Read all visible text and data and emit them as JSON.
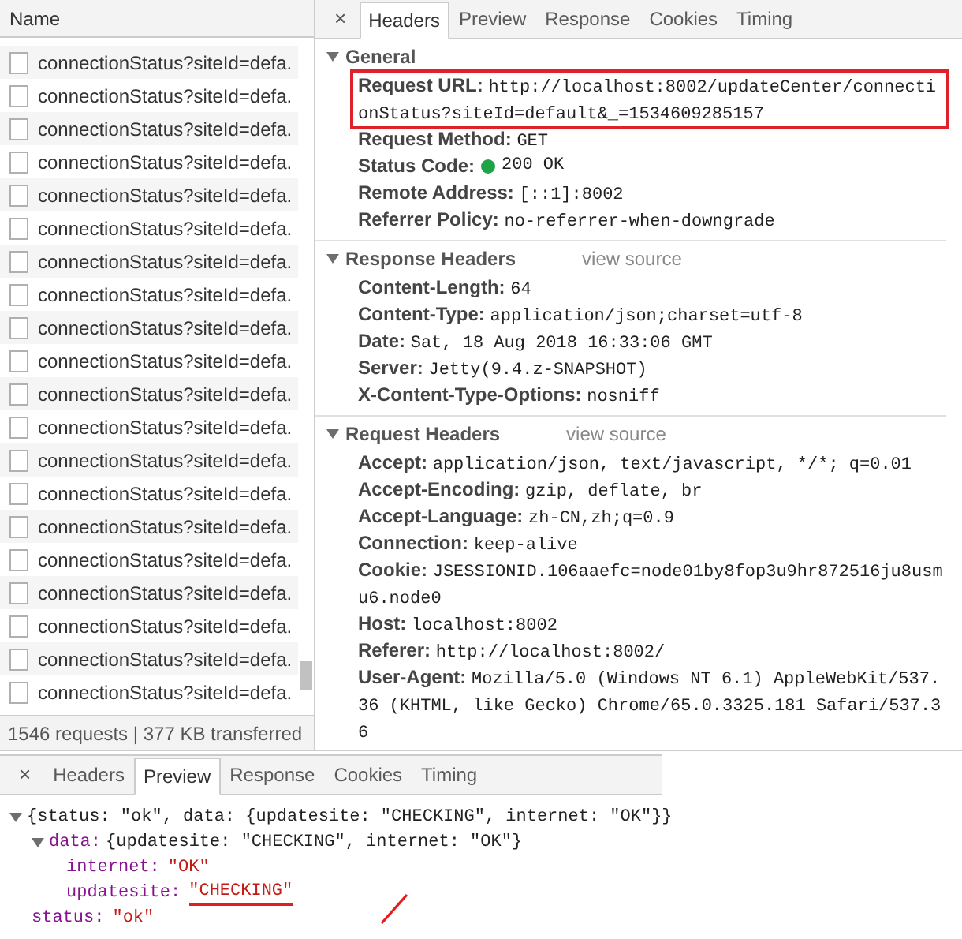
{
  "requests": {
    "header": "Name",
    "rows": [
      "connectionStatus?siteId=defa.",
      "connectionStatus?siteId=defa.",
      "connectionStatus?siteId=defa.",
      "connectionStatus?siteId=defa.",
      "connectionStatus?siteId=defa.",
      "connectionStatus?siteId=defa.",
      "connectionStatus?siteId=defa.",
      "connectionStatus?siteId=defa.",
      "connectionStatus?siteId=defa.",
      "connectionStatus?siteId=defa.",
      "connectionStatus?siteId=defa.",
      "connectionStatus?siteId=defa.",
      "connectionStatus?siteId=defa.",
      "connectionStatus?siteId=defa.",
      "connectionStatus?siteId=defa.",
      "connectionStatus?siteId=defa.",
      "connectionStatus?siteId=defa.",
      "connectionStatus?siteId=defa.",
      "connectionStatus?siteId=defa.",
      "connectionStatus?siteId=defa."
    ],
    "status_bar": "1546 requests | 377 KB transferred"
  },
  "details": {
    "close": "×",
    "tabs": [
      {
        "label": "Headers",
        "selected": true
      },
      {
        "label": "Preview",
        "selected": false
      },
      {
        "label": "Response",
        "selected": false
      },
      {
        "label": "Cookies",
        "selected": false
      },
      {
        "label": "Timing",
        "selected": false
      }
    ],
    "sections": [
      {
        "title": "General",
        "expanded": true,
        "fields": [
          {
            "key": "Request URL:",
            "value": "http://localhost:8002/updateCenter/connectionStatus?siteId=default&_=1534609285157",
            "highlighted": true
          },
          {
            "key": "Request Method:",
            "value": "GET",
            "highlighted": false
          },
          {
            "key": "Status Code:",
            "value": "200 OK",
            "kind": "status",
            "highlighted": false
          },
          {
            "key": "Remote Address:",
            "value": "[::1]:8002",
            "highlighted": false
          },
          {
            "key": "Referrer Policy:",
            "value": "no-referrer-when-downgrade",
            "highlighted": false
          }
        ]
      },
      {
        "title": "Response Headers",
        "link": "view source",
        "expanded": true,
        "fields": [
          {
            "key": "Content-Length:",
            "value": "64",
            "highlighted": false
          },
          {
            "key": "Content-Type:",
            "value": "application/json;charset=utf-8",
            "highlighted": false
          },
          {
            "key": "Date:",
            "value": "Sat, 18 Aug 2018 16:33:06 GMT",
            "highlighted": false
          },
          {
            "key": "Server:",
            "value": "Jetty(9.4.z-SNAPSHOT)",
            "highlighted": false
          },
          {
            "key": "X-Content-Type-Options:",
            "value": "nosniff",
            "highlighted": false
          }
        ]
      },
      {
        "title": "Request Headers",
        "link": "view source",
        "expanded": true,
        "fields": [
          {
            "key": "Accept:",
            "value": "application/json, text/javascript, */*; q=0.01",
            "highlighted": false
          },
          {
            "key": "Accept-Encoding:",
            "value": "gzip, deflate, br",
            "highlighted": false
          },
          {
            "key": "Accept-Language:",
            "value": "zh-CN,zh;q=0.9",
            "highlighted": false
          },
          {
            "key": "Connection:",
            "value": "keep-alive",
            "highlighted": false
          },
          {
            "key": "Cookie:",
            "value": "JSESSIONID.106aaefc=node01by8fop3u9hr872516ju8usmu6.node0",
            "highlighted": false
          },
          {
            "key": "Host:",
            "value": "localhost:8002",
            "highlighted": false
          },
          {
            "key": "Referer:",
            "value": "http://localhost:8002/",
            "highlighted": false
          },
          {
            "key": "User-Agent:",
            "value": "Mozilla/5.0 (Windows NT 6.1) AppleWebKit/537.36 (KHTML, like Gecko) Chrome/65.0.3325.181 Safari/537.36",
            "highlighted": false
          }
        ]
      }
    ]
  },
  "preview": {
    "close": "×",
    "tabs": [
      {
        "label": "Headers",
        "selected": false
      },
      {
        "label": "Preview",
        "selected": true
      },
      {
        "label": "Response",
        "selected": false
      },
      {
        "label": "Cookies",
        "selected": false
      },
      {
        "label": "Timing",
        "selected": false
      }
    ],
    "tree": {
      "summary": "{status: \"ok\", data: {updatesite: \"CHECKING\", internet: \"OK\"}}",
      "expanded": true,
      "children": [
        {
          "key": "data:",
          "summary": "{updatesite: \"CHECKING\", internet: \"OK\"}",
          "expanded": true,
          "children": [
            {
              "key": "internet:",
              "value": "\"OK\"",
              "underlined": false
            },
            {
              "key": "updatesite:",
              "value": "\"CHECKING\"",
              "underlined": true
            }
          ]
        },
        {
          "key": "status:",
          "value": "\"ok\"",
          "underlined": false
        }
      ]
    }
  }
}
